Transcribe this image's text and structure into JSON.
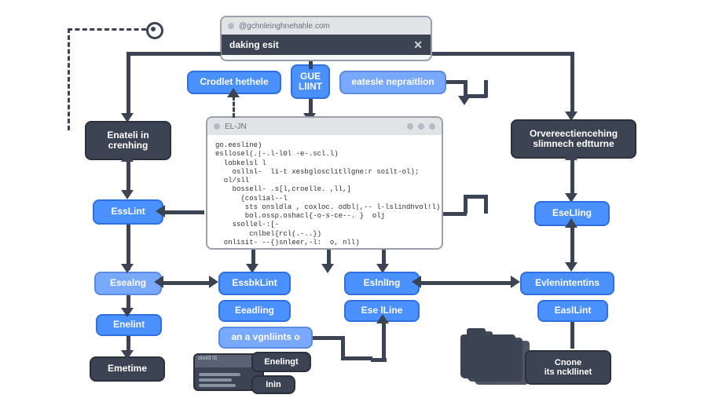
{
  "top_browser": {
    "url": "@gchnleinghnehahle.com",
    "tab_title": "daking esit",
    "close": "✕"
  },
  "code_window": {
    "title": "EL-JN",
    "code": "go.eesline)\nesllosel(.|-.l-l0l -e-.scl.l)\n  lobkelsl l\n    osllsl-  li-t xesbglosclitllgne:r soilt-ol);\n  ol/sll\n    bossell- .s[l,croelle. ,ll,]\n      {coslial--l\n       sts onsldla , coxloc. odbl|,-- l-lslindhvol!l)\n       bol.ossp.oshacl{-o-s-ce--. }  olj\n    ssollel-:[-\n        cnlbel{rcl(.-..})\n  onlisit- --{)snleer,-l:  o, nll)"
  },
  "nodes": {
    "crodlet": "Crodlet hethele",
    "gue": "GUE\nLlINT",
    "eatesle": "eatesle nepraitlion",
    "enateli": "Enateli in crenhing",
    "over": "Orvereectiencehing slimnech edtturne",
    "esslint": "EssLint",
    "eselling_r": "EseLling",
    "esealng": "Esealng",
    "essklint": "EssbkLint",
    "eslnling": "EslnlIng",
    "evlenintins": "Evlenintentins",
    "eadling": "Eeadling",
    "eseline": "Ese lLine",
    "easllint": "EaslLint",
    "enelint": "Enelint",
    "anvgn": "an a vgnliints o",
    "emetime": "Emetime",
    "enelingt": "Enelingt",
    "inin": "Inin"
  },
  "folder": {
    "line1": "Cnone",
    "line2": "its nckllinet"
  },
  "terminal": {
    "head": "oloi0l 0|"
  },
  "colors": {
    "blue": "#4a90ff",
    "dark": "#3c4352"
  }
}
